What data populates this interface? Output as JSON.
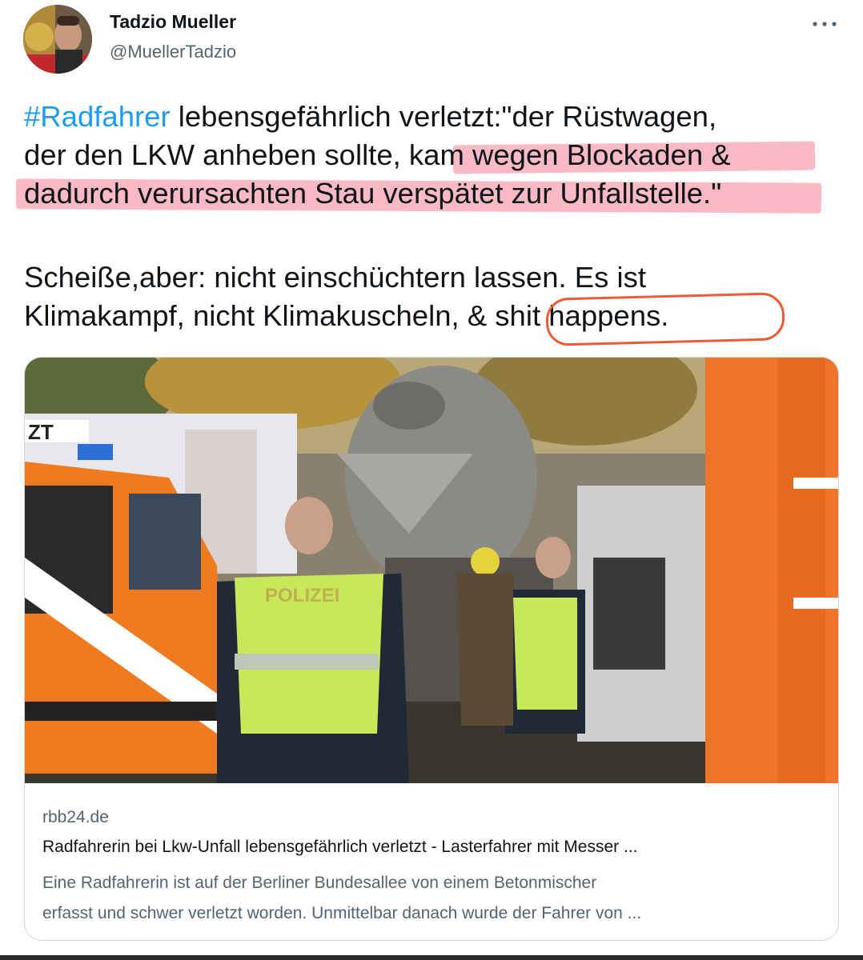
{
  "author": {
    "name": "Tadzio Mueller",
    "handle": "@MuellerTadzio"
  },
  "tweet": {
    "hashtag": "#Radfahrer",
    "line1_rest": " lebensgefährlich verletzt:\"der Rüstwagen,",
    "line2_plain": "der den LKW anheben sollte, ",
    "line2_highlight": "kam wegen Blockaden &",
    "line3_highlight": "dadurch verursachten Stau verspätet zur Unfallstelle.\"",
    "line4": "Scheiße,aber: nicht einschüchtern lassen. Es ist",
    "line5_plain": "Klimakampf, nicht Klimakuscheln, & ",
    "line5_circled": "shit happens."
  },
  "card": {
    "domain": "rbb24.de",
    "title": "Radfahrerin bei Lkw-Unfall lebensgefährlich verletzt - Lasterfahrer mit Messer ...",
    "desc_line1": "Eine Radfahrerin ist auf der Berliner Bundesallee von einem Betonmischer",
    "desc_line2": "erfasst und schwer verletzt worden. Unmittelbar danach wurde der Fahrer von ...",
    "image_vest_text": "POLIZEI",
    "image_sign_text": "ZT"
  },
  "colors": {
    "hashtag": "#1d9bf0",
    "highlight": "#f5a0b0",
    "circle": "#ef5a36",
    "secondary_text": "#536471"
  },
  "icons": {
    "more": "more-horizontal-icon"
  }
}
